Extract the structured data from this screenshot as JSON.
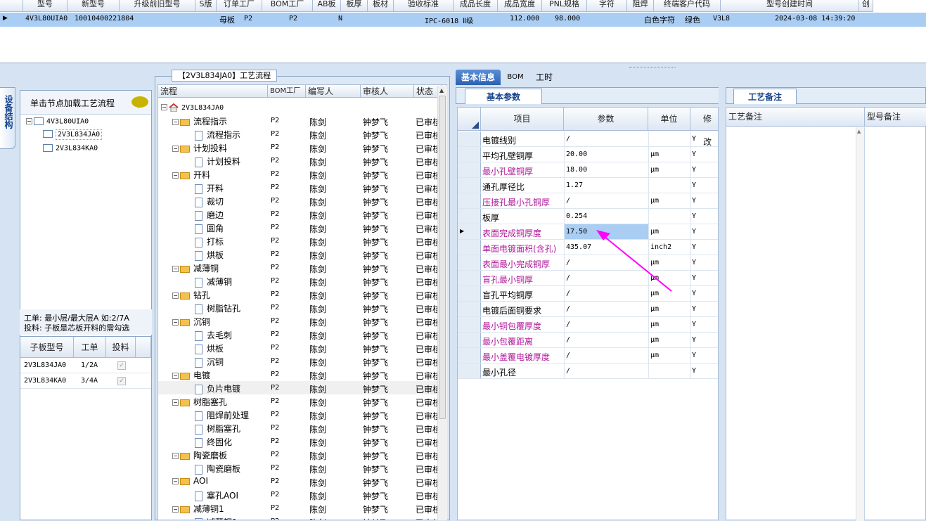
{
  "top_grid": {
    "headers": [
      "",
      "型号",
      "新型号",
      "升级前旧型号",
      "S版",
      "订单工厂",
      "BOM工厂",
      "AB板",
      "板厚",
      "板材",
      "验收标准",
      "成品长度",
      "成品宽度",
      "PNL规格",
      "字符",
      "阻焊",
      "终端客户代码",
      "型号创建时间",
      "创"
    ],
    "row": {
      "model": "4V3L80UIA0",
      "new_model": "10010400221804",
      "board_type": "母板",
      "order_factory": "P2",
      "bom_factory": "P2",
      "ab": "N",
      "standard": "IPC-6018 Ⅱ级",
      "length": "112.000",
      "width": "98.000",
      "char": "白色字符",
      "mask": "绿色",
      "customer": "V3L8",
      "created": "2024-03-08 14:39:20"
    }
  },
  "left": {
    "side_tab": "设备结构",
    "hint": "单击节点加载工艺流程",
    "tree": [
      "4V3L80UIA0",
      "2V3L834JA0",
      "2V3L834KA0"
    ],
    "info_line1": "工单: 最小层/最大层A 如:2/7A",
    "info_line2": "投料: 子板是芯板开料的需勾选",
    "sub_headers": [
      "子板型号",
      "工单",
      "投料"
    ],
    "sub_rows": [
      {
        "model": "2V3L834JA0",
        "wo": "1/2A"
      },
      {
        "model": "2V3L834KA0",
        "wo": "3/4A"
      }
    ]
  },
  "middle": {
    "title": "【2V3L834JA0】工艺流程",
    "headers": [
      "流程",
      "BOM工厂",
      "编写人",
      "审核人",
      "状态"
    ],
    "root": "2V3L834JA0",
    "rows": [
      {
        "name": "流程指示",
        "folder": true
      },
      {
        "name": "流程指示",
        "folder": false
      },
      {
        "name": "计划投料",
        "folder": true
      },
      {
        "name": "计划投料",
        "folder": false
      },
      {
        "name": "开料",
        "folder": true
      },
      {
        "name": "开料",
        "folder": false
      },
      {
        "name": "裁切",
        "folder": false
      },
      {
        "name": "磨边",
        "folder": false
      },
      {
        "name": "圆角",
        "folder": false
      },
      {
        "name": "打标",
        "folder": false
      },
      {
        "name": "烘板",
        "folder": false
      },
      {
        "name": "减薄铜",
        "folder": true
      },
      {
        "name": "减薄铜",
        "folder": false
      },
      {
        "name": "钻孔",
        "folder": true
      },
      {
        "name": "树脂钻孔",
        "folder": false
      },
      {
        "name": "沉铜",
        "folder": true
      },
      {
        "name": "去毛刺",
        "folder": false
      },
      {
        "name": "烘板",
        "folder": false
      },
      {
        "name": "沉铜",
        "folder": false
      },
      {
        "name": "电镀",
        "folder": true
      },
      {
        "name": "负片电镀",
        "folder": false
      },
      {
        "name": "树脂塞孔",
        "folder": true
      },
      {
        "name": "阻焊前处理",
        "folder": false
      },
      {
        "name": "树脂塞孔",
        "folder": false
      },
      {
        "name": "终固化",
        "folder": false
      },
      {
        "name": "陶瓷磨板",
        "folder": true
      },
      {
        "name": "陶瓷磨板",
        "folder": false
      },
      {
        "name": "AOI",
        "folder": true
      },
      {
        "name": "塞孔AOI",
        "folder": false
      },
      {
        "name": "减薄铜1",
        "folder": true
      },
      {
        "name": "减薄铜1",
        "folder": false
      }
    ],
    "bom": "P2",
    "writer": "陈剑",
    "reviewer": "钟梦飞",
    "status": "已审核"
  },
  "right": {
    "tabs": [
      "基本信息",
      "BOM",
      "工时"
    ],
    "subtab": "基本参数",
    "param_headers": [
      "项目",
      "参数",
      "单位",
      "修改"
    ],
    "params": [
      {
        "item": "电镀线别",
        "value": "/",
        "unit": "",
        "mod": "Y",
        "hl": false
      },
      {
        "item": "平均孔壁铜厚",
        "value": "20.00",
        "unit": "μm",
        "mod": "Y",
        "hl": false
      },
      {
        "item": "最小孔壁铜厚",
        "value": "18.00",
        "unit": "μm",
        "mod": "Y",
        "hl": true
      },
      {
        "item": "通孔厚径比",
        "value": "1.27",
        "unit": "",
        "mod": "Y",
        "hl": false
      },
      {
        "item": "压接孔最小孔铜厚",
        "value": "/",
        "unit": "μm",
        "mod": "Y",
        "hl": true
      },
      {
        "item": "板厚",
        "value": "0.254",
        "unit": "",
        "mod": "Y",
        "hl": false
      },
      {
        "item": "表面完成铜厚度",
        "value": "17.50",
        "unit": "μm",
        "mod": "Y",
        "hl": true
      },
      {
        "item": "单面电镀面积(含孔)",
        "value": "435.07",
        "unit": "inch2",
        "mod": "Y",
        "hl": true
      },
      {
        "item": "表面最小完成铜厚",
        "value": "/",
        "unit": "μm",
        "mod": "Y",
        "hl": true
      },
      {
        "item": "盲孔最小铜厚",
        "value": "/",
        "unit": "μm",
        "mod": "Y",
        "hl": true
      },
      {
        "item": "盲孔平均铜厚",
        "value": "/",
        "unit": "μm",
        "mod": "Y",
        "hl": false
      },
      {
        "item": "电镀后面铜要求",
        "value": "/",
        "unit": "μm",
        "mod": "Y",
        "hl": false
      },
      {
        "item": "最小铜包覆厚度",
        "value": "/",
        "unit": "μm",
        "mod": "Y",
        "hl": true
      },
      {
        "item": "最小包覆距离",
        "value": "/",
        "unit": "μm",
        "mod": "Y",
        "hl": true
      },
      {
        "item": "最小盖覆电镀厚度",
        "value": "/",
        "unit": "μm",
        "mod": "Y",
        "hl": true
      },
      {
        "item": "最小孔径",
        "value": "/",
        "unit": "",
        "mod": "Y",
        "hl": false
      }
    ],
    "remarks_tab": "工艺备注",
    "remarks_headers": [
      "工艺备注",
      "型号备注"
    ]
  },
  "colors": {
    "highlight_text": "#b0179a",
    "selected_row": "#a9cdf3",
    "arrow": "#ff00ff"
  }
}
